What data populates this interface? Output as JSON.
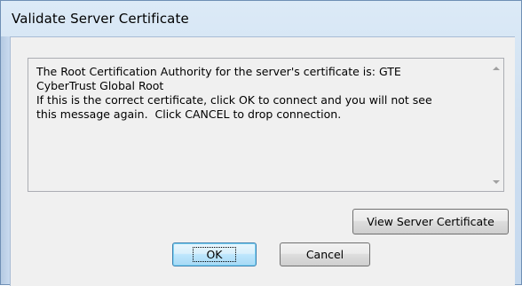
{
  "window": {
    "title": "Validate Server Certificate"
  },
  "message": {
    "text": "The Root Certification Authority for the server's certificate is: GTE\nCyberTrust Global Root\nIf this is the correct certificate, click OK to connect and you will not see\nthis message again.  Click CANCEL to drop connection."
  },
  "scrollbar": {
    "up_icon": "chevron-up-icon",
    "down_icon": "chevron-down-icon"
  },
  "buttons": {
    "view_certificate": "View Server Certificate",
    "ok": "OK",
    "cancel": "Cancel"
  },
  "colors": {
    "title_bar": "#cfe0f1",
    "client_bg": "#f0f0f0",
    "default_button_border": "#3c7fb1"
  }
}
